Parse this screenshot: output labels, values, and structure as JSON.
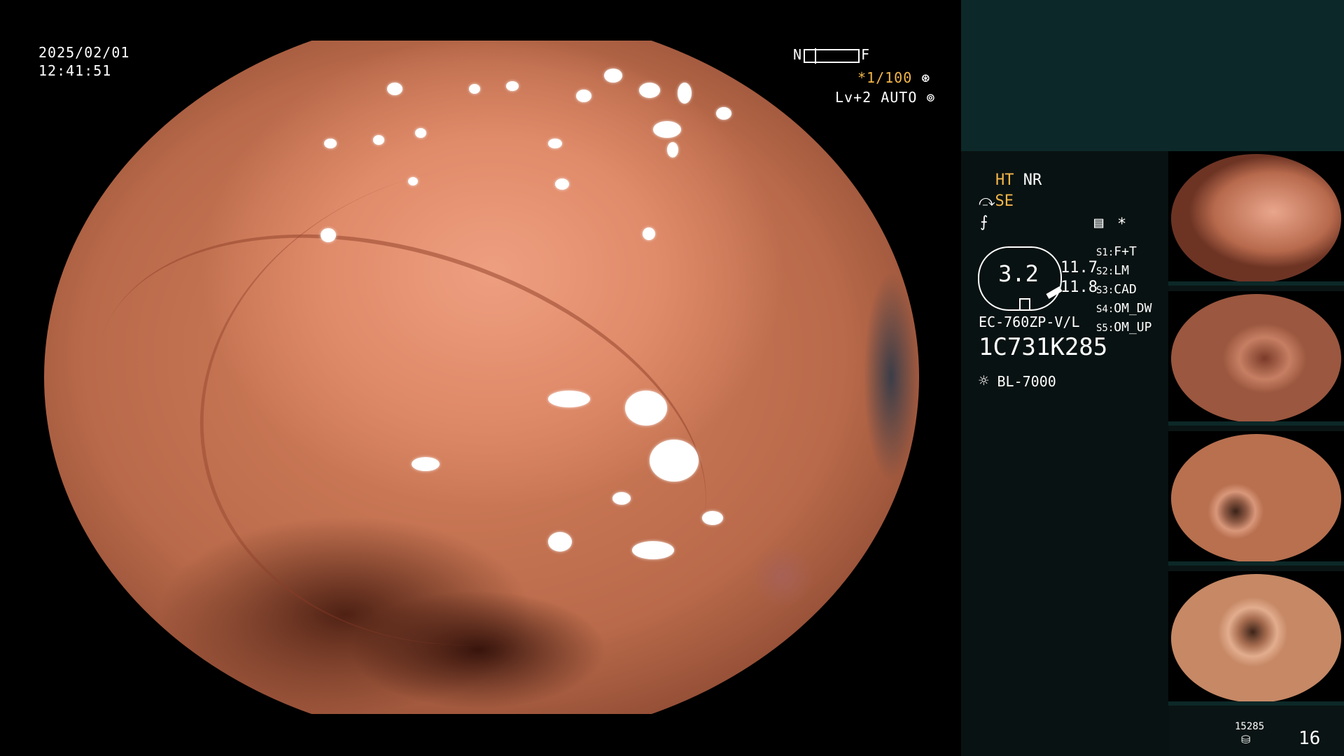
{
  "osd": {
    "date": "2025/02/01",
    "time": "12:41:51",
    "nf_near": "N",
    "nf_far": "F",
    "shutter": "*1/100",
    "level": "Lv+2 AUTO"
  },
  "panel": {
    "ht": "HT",
    "nr": "NR",
    "se": "SE",
    "asterisk": "*",
    "zoom_value": "3.2",
    "val1": "11.7",
    "val2": "11.8",
    "scope_model": "EC-760ZP-V/L",
    "serial": "1C731K285",
    "light": "BL-7000",
    "settings": [
      {
        "key": "S1:",
        "value": "F+T"
      },
      {
        "key": "S2:",
        "value": "LM"
      },
      {
        "key": "S3:",
        "value": "CAD"
      },
      {
        "key": "S4:",
        "value": "OM_DW"
      },
      {
        "key": "S5:",
        "value": "OM_UP"
      }
    ],
    "storage_count": "15285",
    "image_count": "16"
  },
  "colors": {
    "accent_yellow": "#f4b74a",
    "panel_teal": "#0d2828"
  }
}
